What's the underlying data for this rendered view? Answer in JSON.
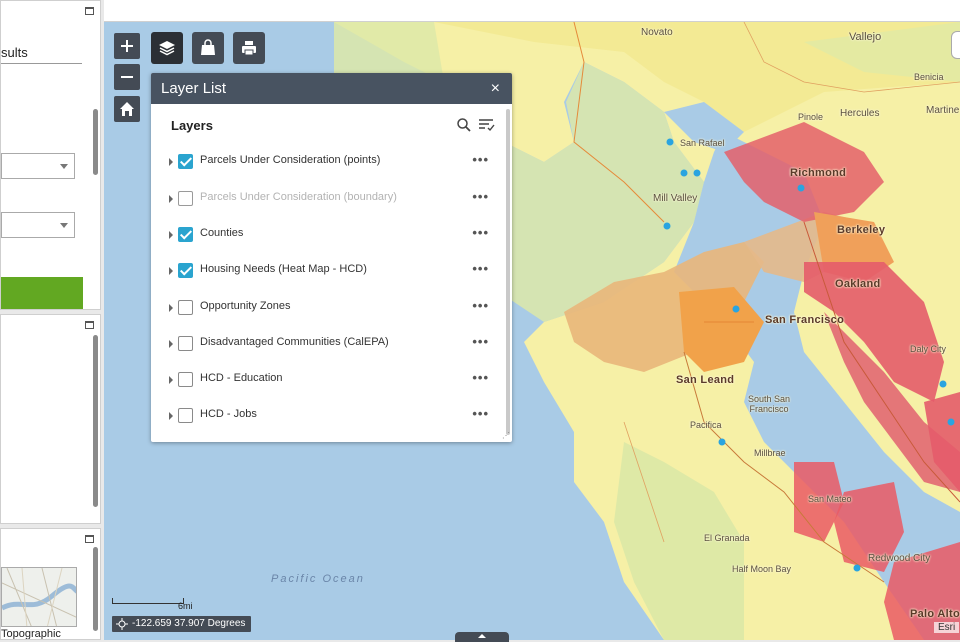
{
  "left_panel": {
    "results_label": "sults",
    "basemap_label": "Topographic"
  },
  "map": {
    "places": [
      "Novato",
      "Vallejo",
      "Benicia",
      "San Rafael",
      "Pinole",
      "Hercules",
      "Martine",
      "Richmond",
      "Mill Valley",
      "Berkeley",
      "Oakland",
      "San Francisco",
      "Daly City",
      "San Leand",
      "South San Francisco",
      "Pacifica",
      "Millbrae",
      "San Mateo",
      "El Granada",
      "Half Moon Bay",
      "Redwood City",
      "Palo Alto"
    ],
    "ocean_label": "Pacific Ocean",
    "scale_label": "6mi",
    "coordinates": "-122.659 37.907 Degrees",
    "attribution": "Esri"
  },
  "layer_list": {
    "title": "Layer List",
    "close": "×",
    "section": "Layers",
    "more": "•••",
    "layers": [
      {
        "label": "Parcels Under Consideration (points)",
        "checked": true,
        "dimmed": false
      },
      {
        "label": "Parcels Under Consideration (boundary)",
        "checked": false,
        "dimmed": true
      },
      {
        "label": "Counties",
        "checked": true,
        "dimmed": false
      },
      {
        "label": "Housing Needs (Heat Map - HCD)",
        "checked": true,
        "dimmed": false
      },
      {
        "label": "Opportunity Zones",
        "checked": false,
        "dimmed": false
      },
      {
        "label": "Disadvantaged Communities (CalEPA)",
        "checked": false,
        "dimmed": false
      },
      {
        "label": "HCD - Education",
        "checked": false,
        "dimmed": false
      },
      {
        "label": "HCD - Jobs",
        "checked": false,
        "dimmed": false
      }
    ]
  },
  "colors": {
    "accent": "#2aa4cf",
    "toolbar": "#444b55",
    "header": "#485361",
    "green_button": "#62a822"
  }
}
